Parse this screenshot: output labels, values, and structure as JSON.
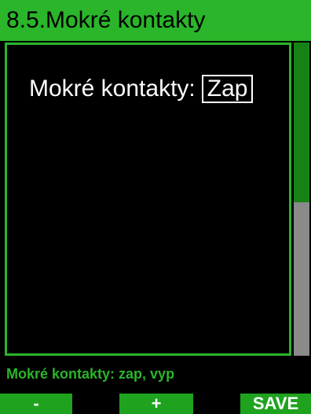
{
  "header": {
    "title": "8.5.Mokré kontakty"
  },
  "setting": {
    "label": "Mokré kontakty:",
    "value": "Zap"
  },
  "scrollbar": {
    "thumb_fraction": 0.51
  },
  "help": {
    "text": "Mokré kontakty: zap, vyp"
  },
  "softkeys": {
    "left": "-",
    "middle": "+",
    "right": "SAVE"
  },
  "colors": {
    "accent": "#2ab52a",
    "softkey_bg": "#1fa31f",
    "scroll_thumb": "#168216",
    "scroll_track": "#8a8a8a",
    "background": "#000000"
  }
}
